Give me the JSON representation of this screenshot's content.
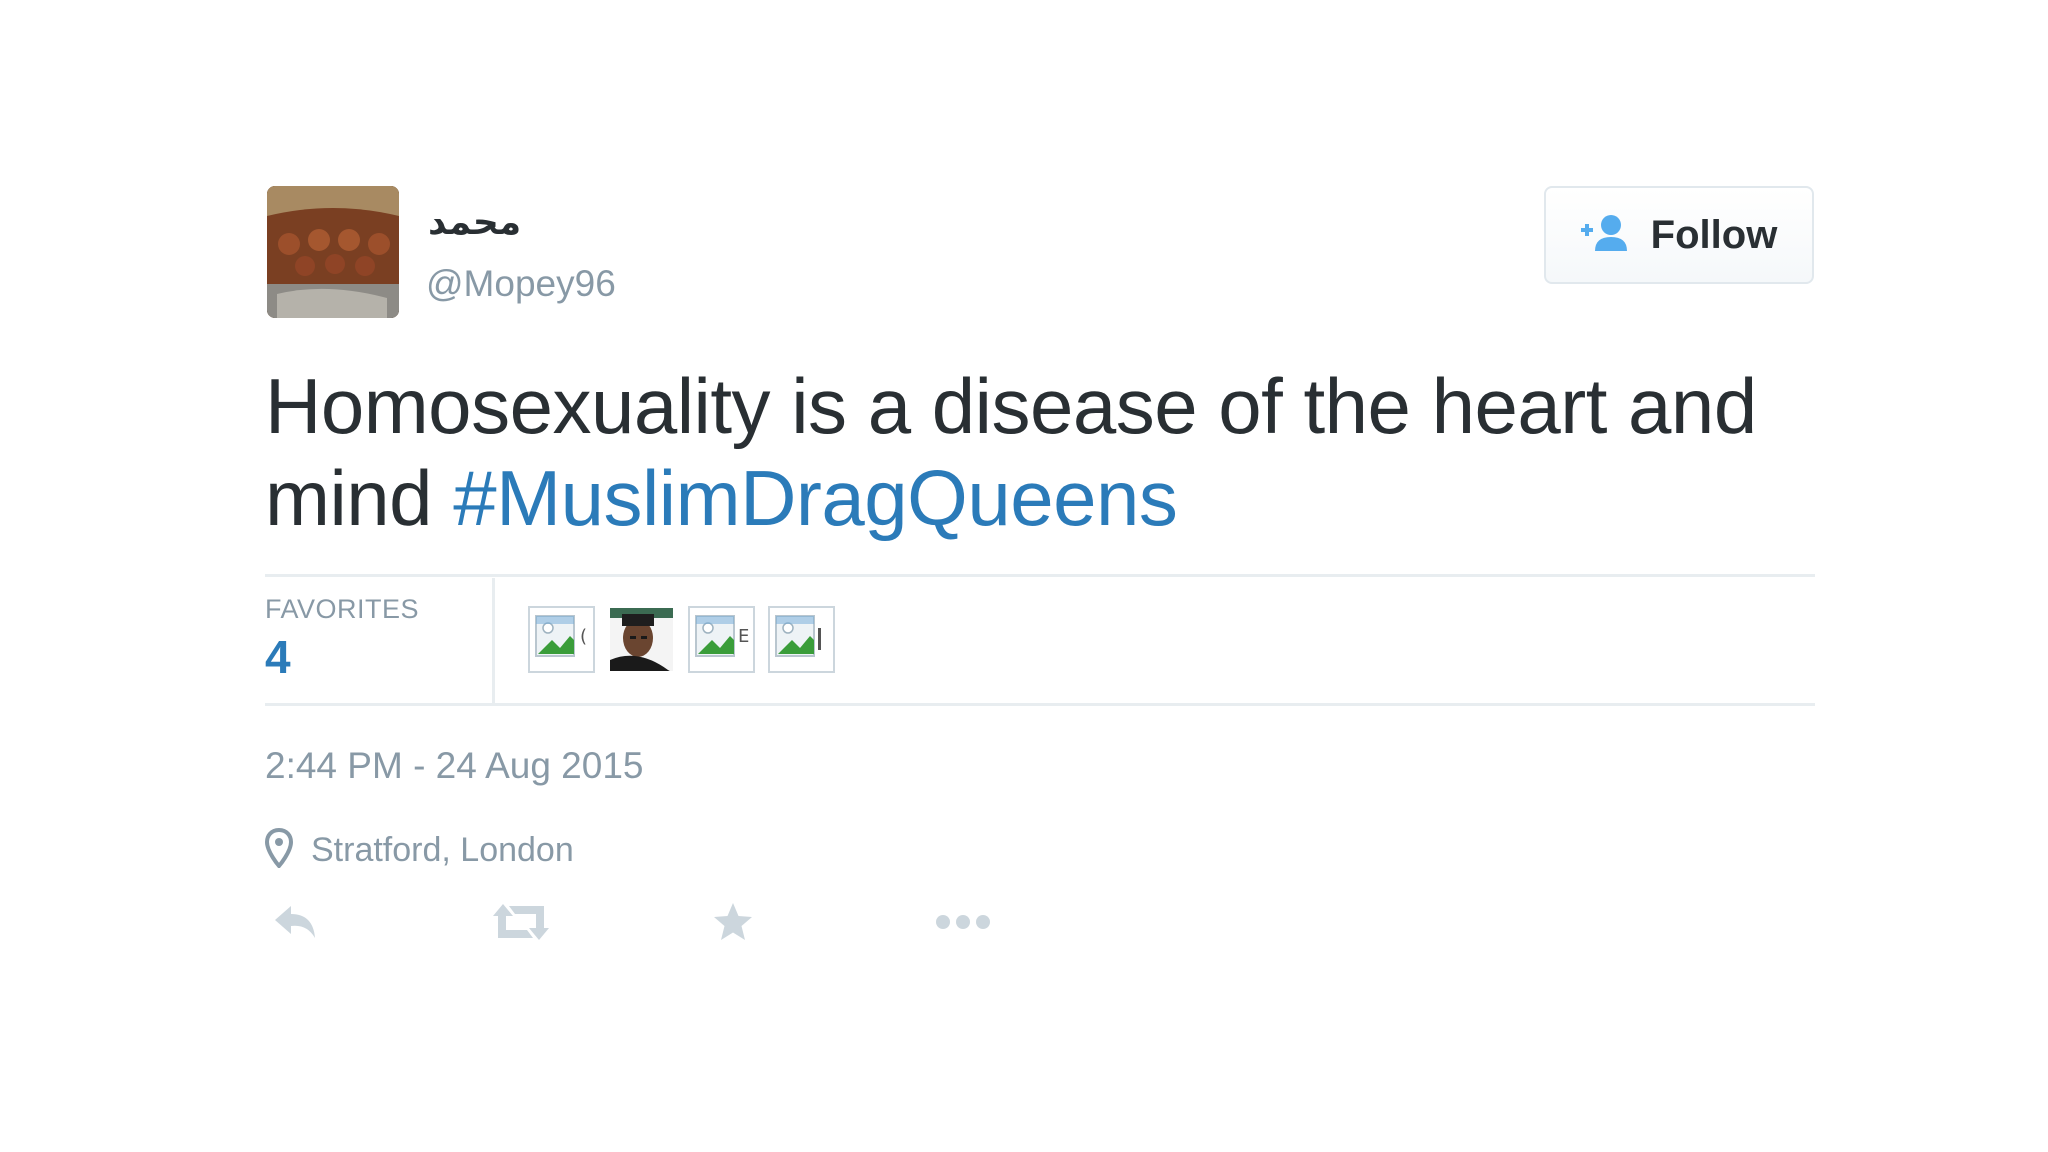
{
  "user": {
    "display_name": "محمد",
    "handle": "@Mopey96"
  },
  "follow_button": {
    "label": "Follow"
  },
  "tweet": {
    "text": "Homosexuality is a disease of the heart and mind ",
    "hashtag": "#MuslimDragQueens"
  },
  "stats": {
    "favorites_label": "FAVORITES",
    "favorites_count": "4"
  },
  "timestamp": "2:44 PM - 24 Aug 2015",
  "location": "Stratford, London",
  "icons": [
    "add-user-icon",
    "location-pin-icon",
    "reply-icon",
    "retweet-icon",
    "favorite-star-icon",
    "more-options-icon"
  ],
  "colors": {
    "link_blue": "#2b7bb9",
    "text_dark": "#292f33",
    "text_gray": "#8899a6",
    "icon_gray": "#ccd6dd",
    "divider": "#e8edf0",
    "follow_icon_blue": "#55acee"
  }
}
